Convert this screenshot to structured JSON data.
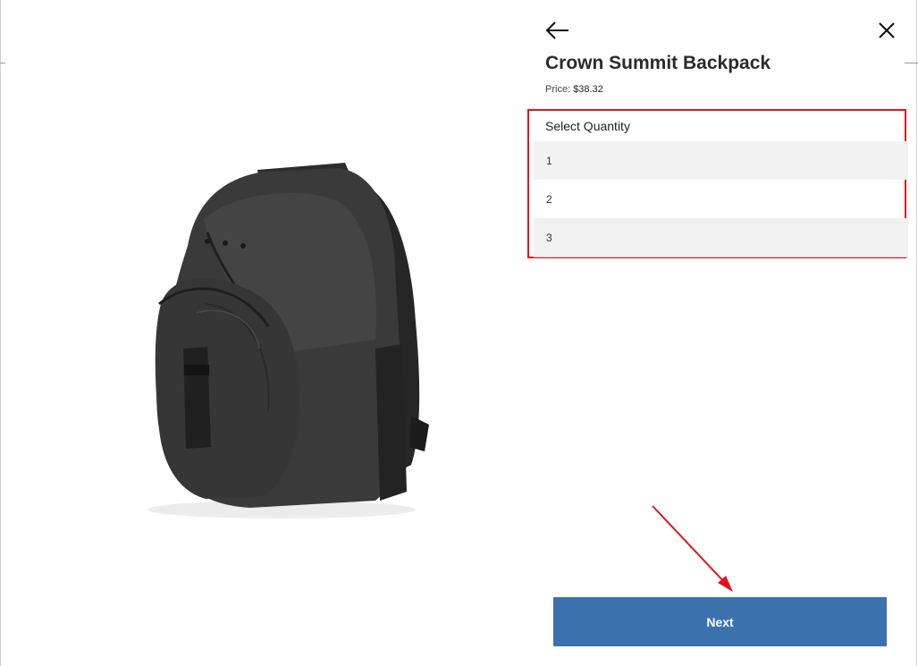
{
  "product": {
    "title": "Crown Summit Backpack",
    "price_label": "Price:",
    "price_value": "$38.32",
    "image_icon": "backpack-image"
  },
  "quantity": {
    "label": "Select Quantity",
    "options": [
      "1",
      "2",
      "3"
    ]
  },
  "actions": {
    "next_label": "Next",
    "back_icon": "arrow-left-icon",
    "close_icon": "close-icon"
  },
  "colors": {
    "accent": "#3b72ad",
    "highlight": "#e0141e"
  }
}
